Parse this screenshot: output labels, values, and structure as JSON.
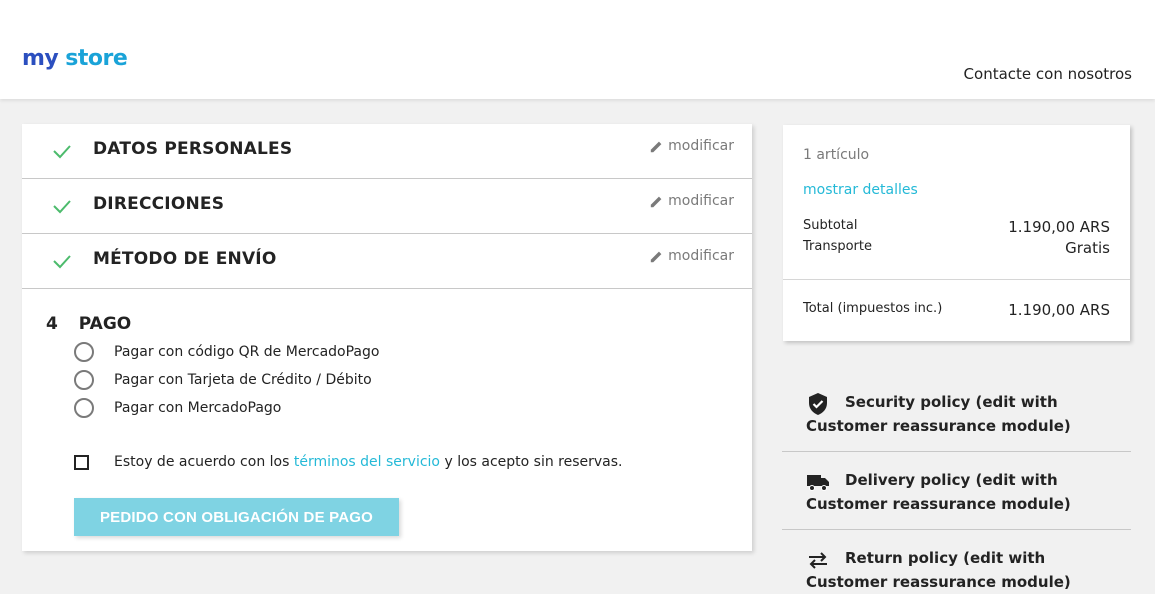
{
  "header": {
    "logo": {
      "part1": "my",
      "part2": "store"
    },
    "contact_link": "Contacte con nosotros"
  },
  "checkout": {
    "steps": [
      {
        "title": "DATOS PERSONALES",
        "edit_label": "modificar"
      },
      {
        "title": "DIRECCIONES",
        "edit_label": "modificar"
      },
      {
        "title": "MÉTODO DE ENVÍO",
        "edit_label": "modificar"
      }
    ],
    "payment": {
      "number": "4",
      "title": "PAGO",
      "options": [
        "Pagar con código QR de MercadoPago",
        "Pagar con Tarjeta de Crédito / Débito",
        "Pagar con MercadoPago"
      ],
      "terms": {
        "before": "Estoy de acuerdo con los",
        "link": "términos del servicio",
        "after": "y los acepto sin reservas."
      },
      "order_button": "PEDIDO CON OBLIGACIÓN DE PAGO"
    }
  },
  "summary": {
    "items_count": "1 artículo",
    "show_details": "mostrar detalles",
    "subtotal_label": "Subtotal",
    "subtotal_value": "1.190,00 ARS",
    "shipping_label": "Transporte",
    "shipping_value": "Gratis",
    "total_label": "Total (impuestos inc.)",
    "total_value": "1.190,00 ARS"
  },
  "reassurance": [
    {
      "icon": "shield-check-icon",
      "text": "Security policy (edit with Customer reassurance module)"
    },
    {
      "icon": "truck-icon",
      "text": "Delivery policy (edit with Customer reassurance module)"
    },
    {
      "icon": "swap-arrows-icon",
      "text": "Return policy (edit with Customer reassurance module)"
    }
  ],
  "colors": {
    "accent": "#24b9d7",
    "check": "#4cbb6c",
    "button_disabled": "#7fd3e3"
  }
}
